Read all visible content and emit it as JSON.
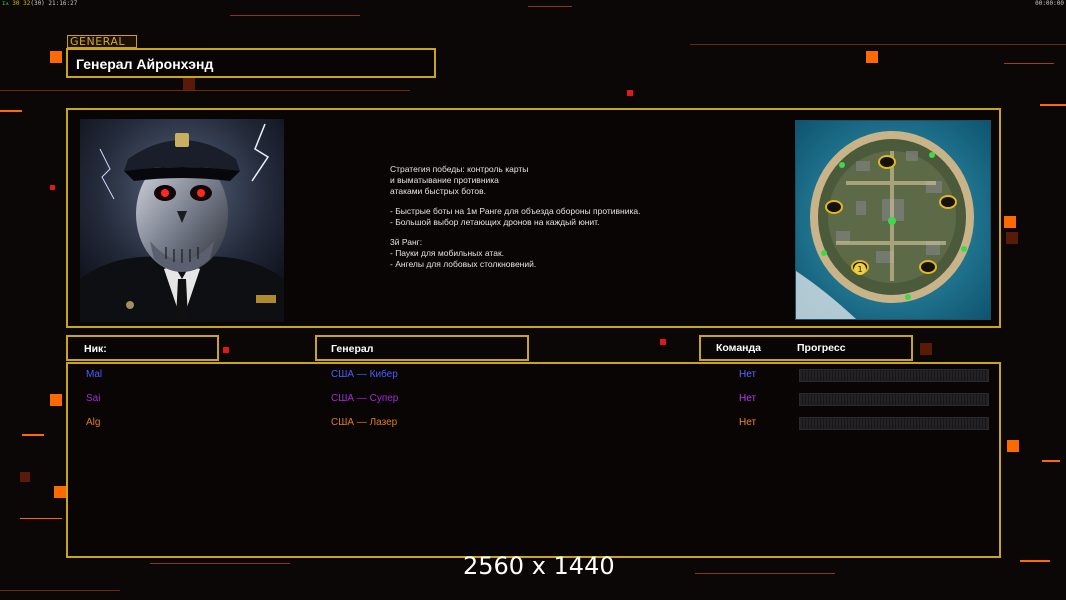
{
  "hud": {
    "fps_label": "ɪᴧ",
    "fps_a": "30",
    "fps_b": "32",
    "fps_c": "(30)",
    "local_time": "21:16:27",
    "game_timer": "00:00:00"
  },
  "general": {
    "tag": "GENERAL",
    "name": "Генерал Айронхэнд"
  },
  "strategy": {
    "lines": [
      "Стратегия победы: контроль карты",
      "и выматывание противника",
      "атаками быстрых ботов.",
      "",
      "- Быстрые боты на 1м Ранге для объезда обороны противника.",
      "- Большой выбор летающих дронов на каждый юнит.",
      "",
      "3й Ранг:",
      "- Пауки для мобильных атак.",
      "- Ангелы для лобовых столкновений."
    ]
  },
  "minimap": {
    "spawn_label": "1"
  },
  "columns": {
    "nick": "Ник:",
    "general": "Генерал",
    "team": "Команда",
    "progress": "Прогресс"
  },
  "players": [
    {
      "nick": "Mal",
      "general": "США — Кибер",
      "team": "Нет",
      "color": "#4a5cff",
      "team_color": "#5a6aff",
      "progress": 0
    },
    {
      "nick": "Sai",
      "general": "США — Супер",
      "team": "Нет",
      "color": "#a22cd8",
      "team_color": "#b83cf0",
      "progress": 0
    },
    {
      "nick": "Alg",
      "general": "США — Лазер",
      "team": "Нет",
      "color": "#e07a1e",
      "team_color": "#f08a2a",
      "progress": 0
    }
  ],
  "colors": {
    "gold": "#c9a518",
    "accent_orange": "#ff6a00",
    "background": "#0b0706"
  },
  "overlay": {
    "resolution_text": "2560 x 1440"
  }
}
